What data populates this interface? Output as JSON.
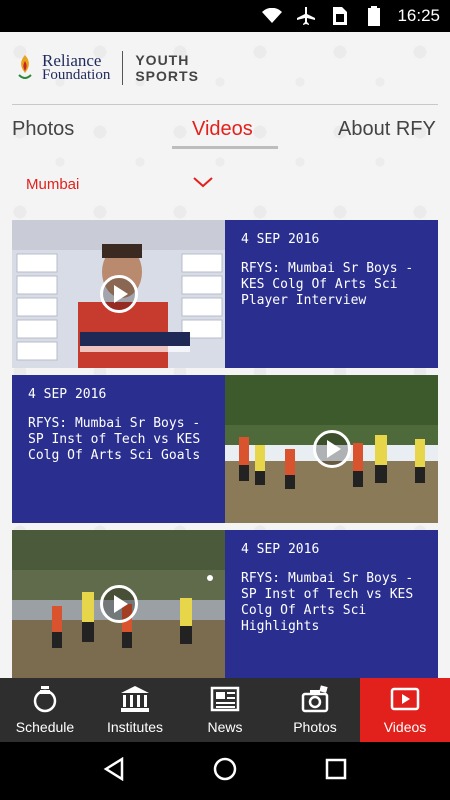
{
  "status_bar": {
    "time": "16:25",
    "icons": [
      "wifi-icon",
      "airplane-icon",
      "sim-icon",
      "battery-icon"
    ]
  },
  "header": {
    "logo_line1": "Reliance",
    "logo_line2": "Foundation",
    "brand_line1": "YOUTH",
    "brand_line2": "SPORTS"
  },
  "tabs": [
    {
      "label": "Photos",
      "active": false
    },
    {
      "label": "Videos",
      "active": true
    },
    {
      "label": "About RFY",
      "active": false
    }
  ],
  "city_filter": {
    "selected": "Mumbai"
  },
  "videos": [
    {
      "date": "4 SEP 2016",
      "title": "RFYS: Mumbai Sr Boys - KES Colg Of Arts  Sci Player Interview"
    },
    {
      "date": "4 SEP 2016",
      "title": "RFYS: Mumbai Sr Boys - SP Inst of Tech vs KES Colg Of Arts  Sci Goals"
    },
    {
      "date": "4 SEP 2016",
      "title": "RFYS: Mumbai Sr Boys - SP Inst of Tech vs KES Colg Of Arts  Sci Highlights"
    }
  ],
  "bottom_nav": [
    {
      "label": "Schedule",
      "icon": "stopwatch-icon",
      "active": false
    },
    {
      "label": "Institutes",
      "icon": "institution-icon",
      "active": false
    },
    {
      "label": "News",
      "icon": "newspaper-icon",
      "active": false
    },
    {
      "label": "Photos",
      "icon": "camera-photos-icon",
      "active": false
    },
    {
      "label": "Videos",
      "icon": "video-icon",
      "active": true
    }
  ],
  "colors": {
    "accent": "#e2211c",
    "card_blue": "#2a2f8f",
    "nav_bg": "#2e2e2e"
  }
}
